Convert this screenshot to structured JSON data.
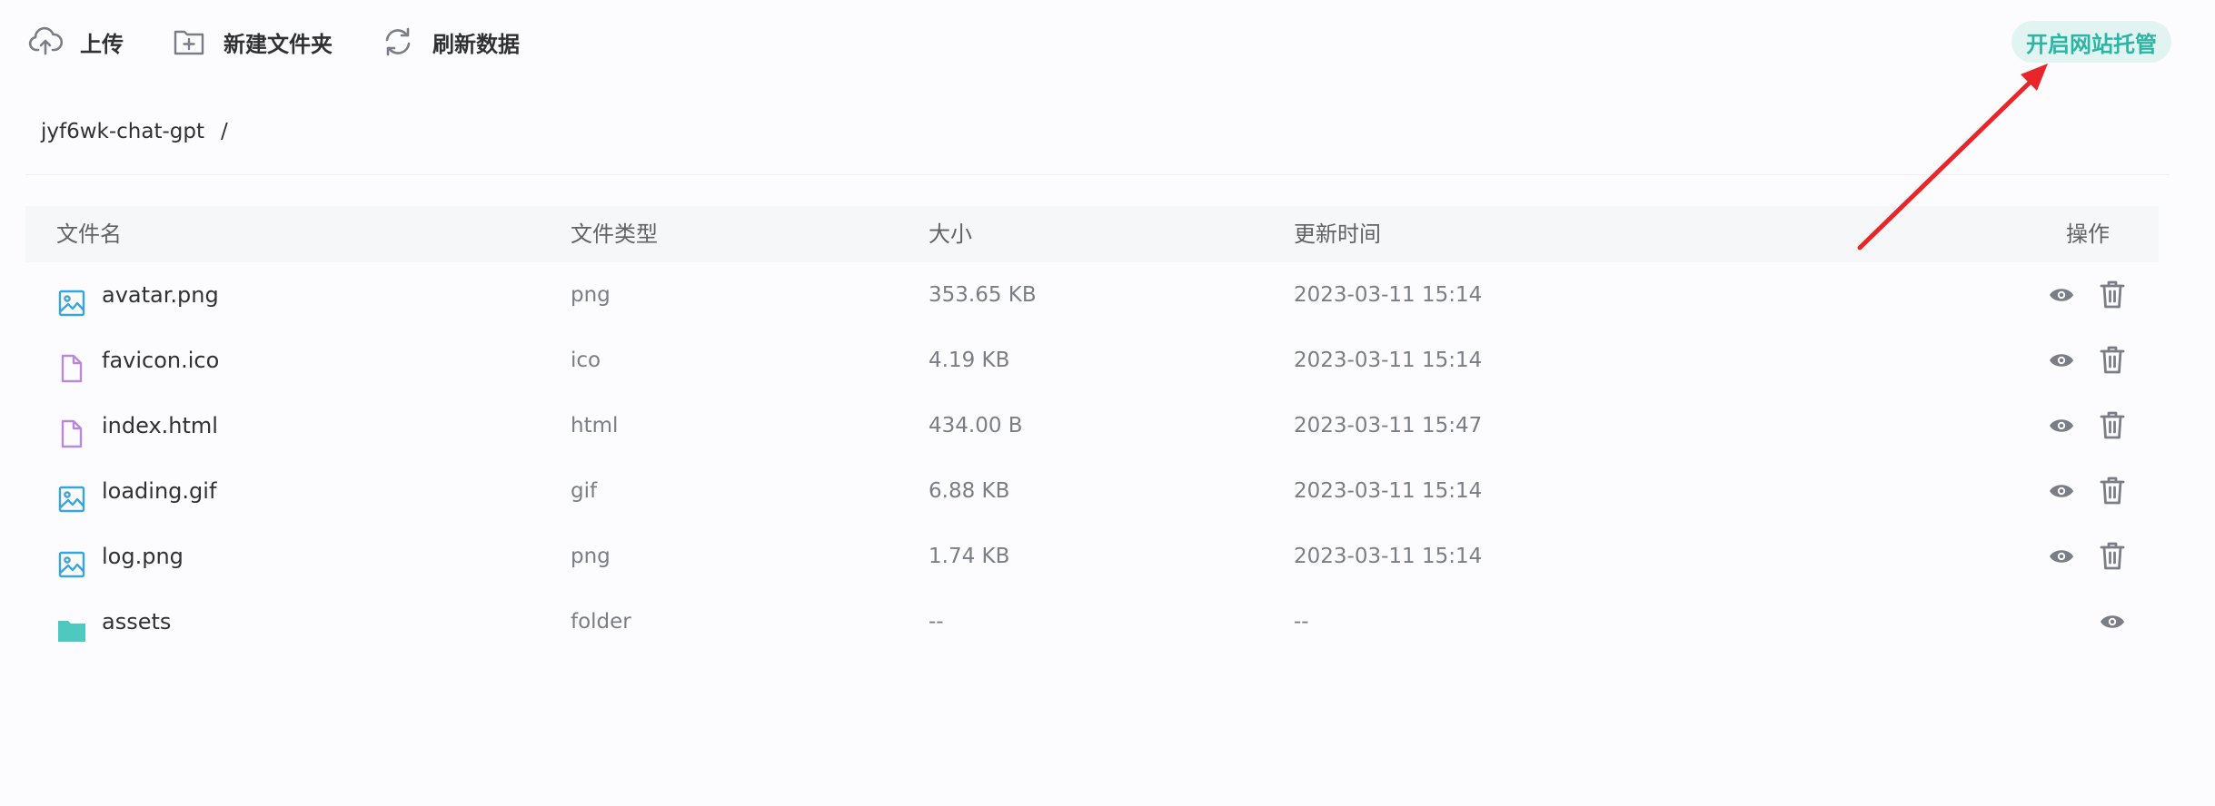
{
  "toolbar": {
    "upload_label": "上传",
    "new_folder_label": "新建文件夹",
    "refresh_label": "刷新数据",
    "hosting_label": "开启网站托管"
  },
  "breadcrumb": {
    "bucket": "jyf6wk-chat-gpt",
    "separator": "/"
  },
  "table": {
    "headers": {
      "name": "文件名",
      "type": "文件类型",
      "size": "大小",
      "time": "更新时间",
      "actions": "操作"
    },
    "rows": [
      {
        "name": "avatar.png",
        "type": "png",
        "size": "353.65 KB",
        "time": "2023-03-11 15:14",
        "icon": "image-file-icon"
      },
      {
        "name": "favicon.ico",
        "type": "ico",
        "size": "4.19 KB",
        "time": "2023-03-11 15:14",
        "icon": "document-file-icon"
      },
      {
        "name": "index.html",
        "type": "html",
        "size": "434.00 B",
        "time": "2023-03-11 15:47",
        "icon": "document-file-icon"
      },
      {
        "name": "loading.gif",
        "type": "gif",
        "size": "6.88 KB",
        "time": "2023-03-11 15:14",
        "icon": "image-file-icon"
      },
      {
        "name": "log.png",
        "type": "png",
        "size": "1.74 KB",
        "time": "2023-03-11 15:14",
        "icon": "image-file-icon"
      },
      {
        "name": "assets",
        "type": "folder",
        "size": "--",
        "time": "--",
        "icon": "folder-icon"
      }
    ]
  },
  "colors": {
    "accent": "#2bb5a4",
    "image_icon": "#3aa5d8",
    "doc_icon": "#b889d6",
    "folder_icon": "#4ec9bf",
    "annotation_arrow": "#e8262a"
  }
}
